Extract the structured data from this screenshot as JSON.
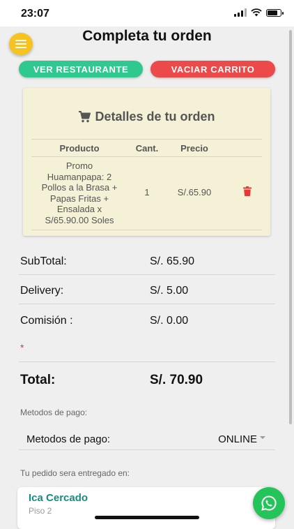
{
  "status_bar": {
    "time": "23:07"
  },
  "header": {
    "title": "Completa tu orden",
    "menu_icon": "hamburger-menu-icon"
  },
  "actions": {
    "view_restaurant": "VER RESTAURANTE",
    "empty_cart": "VACIAR CARRITO"
  },
  "colors": {
    "accent_green": "#2fc98f",
    "accent_red": "#ec4a4a",
    "menu_yellow": "#f6c320",
    "card_bg": "#f4f1d6",
    "address_teal": "#168b7f",
    "whatsapp_green": "#25c45a"
  },
  "order": {
    "title": "Detalles de tu orden",
    "title_icon": "cart-icon",
    "columns": {
      "product": "Producto",
      "qty": "Cant.",
      "price": "Precio"
    },
    "items": [
      {
        "product_lines": [
          "Promo",
          "Huamanpapa: 2",
          "Pollos a la Brasa +",
          "Papas Fritas +",
          "Ensalada x",
          "S/65.90.00 Soles"
        ],
        "qty": "1",
        "price": "S/.65.90",
        "delete_icon": "trash-icon"
      }
    ]
  },
  "summary": {
    "subtotal_label": "SubTotal:",
    "subtotal_value": "S/. 65.90",
    "delivery_label": "Delivery:",
    "delivery_value": "S/. 5.00",
    "commission_label": "Comisión :",
    "commission_value": "S/. 0.00",
    "required_mark": "*",
    "total_label": "Total:",
    "total_value": "S/. 70.90"
  },
  "payment": {
    "section_label": "Metodos de pago:",
    "field_label": "Metodos de pago:",
    "selected": "ONLINE"
  },
  "delivery": {
    "section_label": "Tu pedido sera entregado en:",
    "address_name": "Ica Cercado",
    "address_detail": "Piso 2",
    "whatsapp_icon": "whatsapp-icon"
  }
}
